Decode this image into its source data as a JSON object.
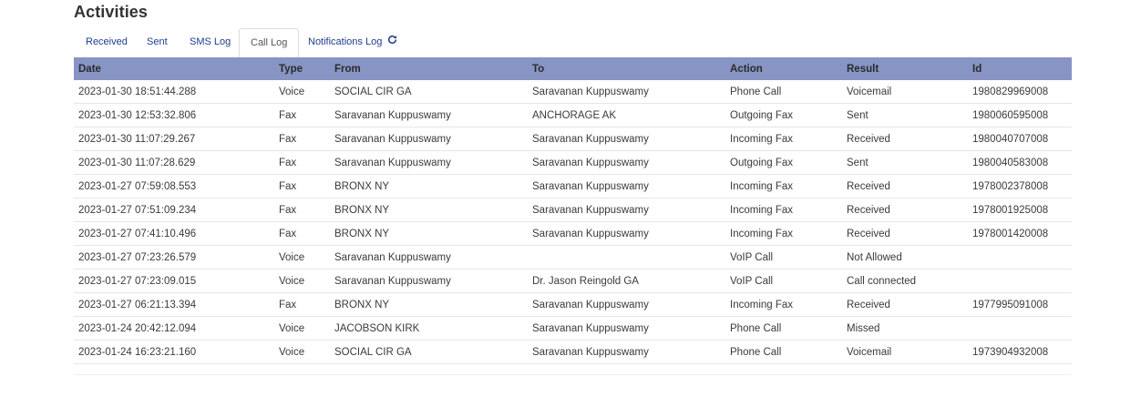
{
  "page": {
    "title": "Activities"
  },
  "tabs": [
    {
      "label": "Received"
    },
    {
      "label": "Sent"
    },
    {
      "label": "SMS Log"
    },
    {
      "label": "Call Log",
      "active": true
    },
    {
      "label": "Notifications Log",
      "icon": "refresh-icon"
    }
  ],
  "table": {
    "headers": [
      "Date",
      "Type",
      "From",
      "To",
      "Action",
      "Result",
      "Id"
    ],
    "rows": [
      [
        "2023-01-30 18:51:44.288",
        "Voice",
        "SOCIAL CIR GA",
        "Saravanan Kuppuswamy",
        "Phone Call",
        "Voicemail",
        "1980829969008"
      ],
      [
        "2023-01-30 12:53:32.806",
        "Fax",
        "Saravanan Kuppuswamy",
        "ANCHORAGE AK",
        "Outgoing Fax",
        "Sent",
        "1980060595008"
      ],
      [
        "2023-01-30 11:07:29.267",
        "Fax",
        "Saravanan Kuppuswamy",
        "Saravanan Kuppuswamy",
        "Incoming Fax",
        "Received",
        "1980040707008"
      ],
      [
        "2023-01-30 11:07:28.629",
        "Fax",
        "Saravanan Kuppuswamy",
        "Saravanan Kuppuswamy",
        "Outgoing Fax",
        "Sent",
        "1980040583008"
      ],
      [
        "2023-01-27 07:59:08.553",
        "Fax",
        "BRONX NY",
        "Saravanan Kuppuswamy",
        "Incoming Fax",
        "Received",
        "1978002378008"
      ],
      [
        "2023-01-27 07:51:09.234",
        "Fax",
        "BRONX NY",
        "Saravanan Kuppuswamy",
        "Incoming Fax",
        "Received",
        "1978001925008"
      ],
      [
        "2023-01-27 07:41:10.496",
        "Fax",
        "BRONX NY",
        "Saravanan Kuppuswamy",
        "Incoming Fax",
        "Received",
        "1978001420008"
      ],
      [
        "2023-01-27 07:23:26.579",
        "Voice",
        "Saravanan Kuppuswamy",
        "",
        "VoIP Call",
        "Not Allowed",
        ""
      ],
      [
        "2023-01-27 07:23:09.015",
        "Voice",
        "Saravanan Kuppuswamy",
        "Dr. Jason Reingold GA",
        "VoIP Call",
        "Call connected",
        ""
      ],
      [
        "2023-01-27 06:21:13.394",
        "Fax",
        "BRONX NY",
        "Saravanan Kuppuswamy",
        "Incoming Fax",
        "Received",
        "1977995091008"
      ],
      [
        "2023-01-24 20:42:12.094",
        "Voice",
        "JACOBSON KIRK",
        "Saravanan Kuppuswamy",
        "Phone Call",
        "Missed",
        ""
      ],
      [
        "2023-01-24 16:23:21.160",
        "Voice",
        "SOCIAL CIR GA",
        "Saravanan Kuppuswamy",
        "Phone Call",
        "Voicemail",
        "1973904932008"
      ]
    ]
  },
  "colors": {
    "header_bg": "#8794c4",
    "tab_link": "#1d3c8f",
    "row_border": "#e6e6e6"
  }
}
